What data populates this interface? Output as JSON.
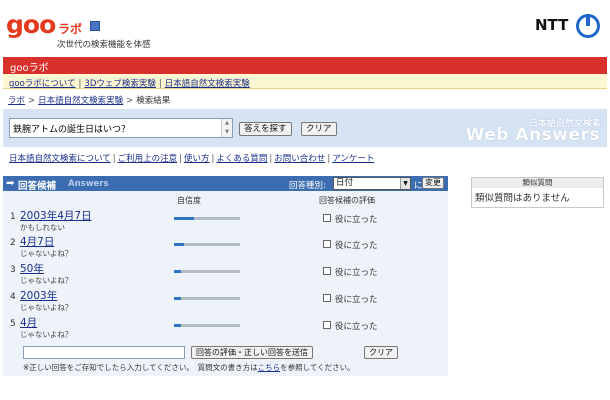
{
  "header": {
    "logo_goo": "goo",
    "logo_labo": "ラボ",
    "tagline": "次世代の検索機能を体感",
    "ntt_logo": "NTT"
  },
  "redbar": {
    "title": "gooラボ"
  },
  "nav": {
    "items": [
      "gooラボについて",
      "3Dウェブ検索実験",
      "日本語自然文検索実験"
    ],
    "sep": "|"
  },
  "breadcrumb": {
    "items": [
      "ラボ",
      "日本語自然文検索実験",
      "検索結果"
    ],
    "sep": ">"
  },
  "search": {
    "query": "鉄腕アトムの誕生日はいつ？",
    "search_button": "答えを探す",
    "clear_button": "クリア",
    "brand_jp": "日本語自然文検索",
    "brand_en": "Web Answers"
  },
  "links": {
    "items": [
      "日本語自然文検索について",
      "ご利用上の注意",
      "使い方",
      "よくある質問",
      "お問い合わせ",
      "アンケート"
    ],
    "sep": "|"
  },
  "candidates": {
    "title": "回答候補",
    "title_en": "Answers",
    "type_label": "回答種別:",
    "type_value": "日付",
    "type_suffix": "に",
    "change_button": "変更",
    "col_confidence": "自信度",
    "col_evaluation": "回答候補の評価",
    "check_label": "役に立った",
    "rows": [
      {
        "num": "1",
        "answer": "2003年4月7日",
        "sub": "かもしれない",
        "confidence": 0.3
      },
      {
        "num": "2",
        "answer": "4月7日",
        "sub": "じゃないよね？",
        "confidence": 0.15
      },
      {
        "num": "3",
        "answer": "50年",
        "sub": "じゃないよね？",
        "confidence": 0.1
      },
      {
        "num": "4",
        "answer": "2003年",
        "sub": "じゃないよね？",
        "confidence": 0.1
      },
      {
        "num": "5",
        "answer": "4月",
        "sub": "じゃないよね？",
        "confidence": 0.1
      }
    ],
    "submit_button": "回答の評価・正しい回答を送信",
    "clear_button": "クリア",
    "note_before": "※正しい回答をご存知でしたら入力してください。　質問文の書き方は",
    "note_link": "こちら",
    "note_after": "を参照してください。"
  },
  "similar": {
    "title": "類似質問",
    "body": "類似質問はありません"
  },
  "colors": {
    "brand_red": "#d8302a",
    "nav_bg": "#fdf6d3",
    "search_bg": "#d6e3f3",
    "panel_blue": "#3b6db0",
    "link_blue": "#1a2f8a"
  }
}
